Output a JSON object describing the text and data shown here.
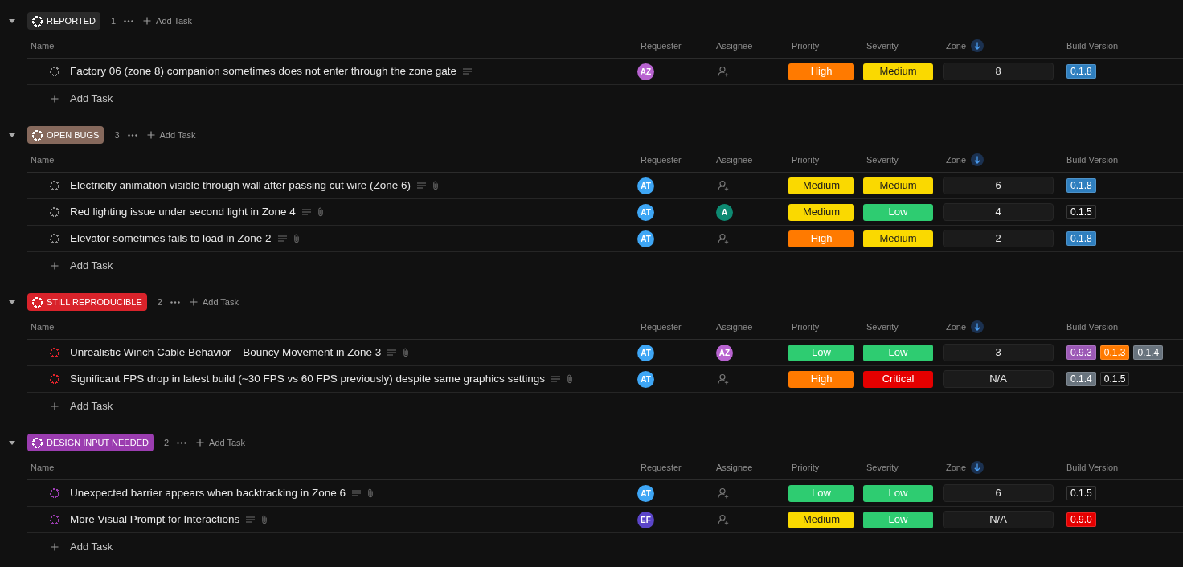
{
  "groups": [
    {
      "name": "REPORTED",
      "color": "#2a2a2a",
      "expanded": true,
      "count": "1",
      "add_task": "Add Task",
      "columns": [
        {
          "label": "Name",
          "sorted": false
        },
        {
          "label": "Requester",
          "sorted": false
        },
        {
          "label": "Assignee",
          "sorted": false
        },
        {
          "label": "Priority",
          "sorted": false
        },
        {
          "label": "Severity",
          "sorted": false
        },
        {
          "label": "Zone",
          "sorted": true
        },
        {
          "label": "Build Version",
          "sorted": false
        }
      ],
      "tasks": [
        {
          "name": "Factory 06 (zone 8) companion sometimes does not enter through the zone gate",
          "color": "#8f8f8f",
          "has_description": true,
          "has_attachment": false,
          "requester": {
            "initials": "AZ",
            "color": "#b863d0"
          },
          "priority": {
            "label": "High",
            "color": "#ff7a00"
          },
          "severity": {
            "label": "Medium",
            "color": "#fad900"
          },
          "zone": "8",
          "build_versions": [
            {
              "label": "0.1.8",
              "color": "#2f7fbf"
            }
          ]
        }
      ],
      "add_task_row": "Add Task"
    },
    {
      "name": "OPEN BUGS",
      "color": "#86695c",
      "expanded": true,
      "count": "3",
      "add_task": "Add Task",
      "columns": [
        {
          "label": "Name",
          "sorted": false
        },
        {
          "label": "Requester",
          "sorted": false
        },
        {
          "label": "Assignee",
          "sorted": false
        },
        {
          "label": "Priority",
          "sorted": false
        },
        {
          "label": "Severity",
          "sorted": false
        },
        {
          "label": "Zone",
          "sorted": true
        },
        {
          "label": "Build Version",
          "sorted": false
        }
      ],
      "tasks": [
        {
          "name": "Electricity animation visible through wall after passing cut wire (Zone 6)",
          "color": "#8f8f8f",
          "has_description": true,
          "has_attachment": true,
          "requester": {
            "initials": "AT",
            "color": "#3ea6f5"
          },
          "priority": {
            "label": "Medium",
            "color": "#fad900"
          },
          "severity": {
            "label": "Medium",
            "color": "#fad900"
          },
          "zone": "6",
          "build_versions": [
            {
              "label": "0.1.8",
              "color": "#2f7fbf"
            }
          ]
        },
        {
          "name": "Red lighting issue under second light in Zone 4",
          "color": "#8f8f8f",
          "has_description": true,
          "has_attachment": true,
          "requester": {
            "initials": "AT",
            "color": "#3ea6f5"
          },
          "assignee": {
            "initials": "A",
            "color": "#0e8a72"
          },
          "priority": {
            "label": "Medium",
            "color": "#fad900"
          },
          "severity": {
            "label": "Low",
            "color": "#2ecc71"
          },
          "zone": "4",
          "build_versions": [
            {
              "label": "0.1.5",
              "color": "#141414"
            }
          ]
        },
        {
          "name": "Elevator sometimes fails to load in Zone 2",
          "color": "#8f8f8f",
          "has_description": true,
          "has_attachment": true,
          "requester": {
            "initials": "AT",
            "color": "#3ea6f5"
          },
          "priority": {
            "label": "High",
            "color": "#ff7a00"
          },
          "severity": {
            "label": "Medium",
            "color": "#fad900"
          },
          "zone": "2",
          "build_versions": [
            {
              "label": "0.1.8",
              "color": "#2f7fbf"
            }
          ]
        }
      ],
      "add_task_row": "Add Task"
    },
    {
      "name": "STILL REPRODUCIBLE",
      "color": "#d9232b",
      "expanded": true,
      "count": "2",
      "add_task": "Add Task",
      "columns": [
        {
          "label": "Name",
          "sorted": false
        },
        {
          "label": "Requester",
          "sorted": false
        },
        {
          "label": "Assignee",
          "sorted": false
        },
        {
          "label": "Priority",
          "sorted": false
        },
        {
          "label": "Severity",
          "sorted": false
        },
        {
          "label": "Zone",
          "sorted": true
        },
        {
          "label": "Build Version",
          "sorted": false
        }
      ],
      "tasks": [
        {
          "name": "Unrealistic Winch Cable Behavior – Bouncy Movement in Zone 3",
          "color": "#e0242c",
          "has_description": true,
          "has_attachment": true,
          "requester": {
            "initials": "AT",
            "color": "#3ea6f5"
          },
          "assignee": {
            "initials": "AZ",
            "color": "#b863d0"
          },
          "priority": {
            "label": "Low",
            "color": "#2ecc71"
          },
          "severity": {
            "label": "Low",
            "color": "#2ecc71"
          },
          "zone": "3",
          "build_versions": [
            {
              "label": "0.9.3",
              "color": "#9c59b6"
            },
            {
              "label": "0.1.3",
              "color": "#ff7a00"
            },
            {
              "label": "0.1.4",
              "color": "#68737d"
            }
          ]
        },
        {
          "name": "Significant FPS drop in latest build (~30 FPS vs 60 FPS previously) despite same graphics settings",
          "color": "#e0242c",
          "has_description": true,
          "has_attachment": true,
          "requester": {
            "initials": "AT",
            "color": "#3ea6f5"
          },
          "priority": {
            "label": "High",
            "color": "#ff7a00"
          },
          "severity": {
            "label": "Critical",
            "color": "#e50000"
          },
          "zone": "N/A",
          "build_versions": [
            {
              "label": "0.1.4",
              "color": "#68737d"
            },
            {
              "label": "0.1.5",
              "color": "#141414"
            }
          ]
        }
      ],
      "add_task_row": "Add Task"
    },
    {
      "name": "DESIGN INPUT NEEDED",
      "color": "#9b3db0",
      "expanded": true,
      "count": "2",
      "add_task": "Add Task",
      "columns": [
        {
          "label": "Name",
          "sorted": false
        },
        {
          "label": "Requester",
          "sorted": false
        },
        {
          "label": "Assignee",
          "sorted": false
        },
        {
          "label": "Priority",
          "sorted": false
        },
        {
          "label": "Severity",
          "sorted": false
        },
        {
          "label": "Zone",
          "sorted": true
        },
        {
          "label": "Build Version",
          "sorted": false
        }
      ],
      "tasks": [
        {
          "name": "Unexpected barrier appears when backtracking in Zone 6",
          "color": "#9b3db0",
          "has_description": true,
          "has_attachment": true,
          "requester": {
            "initials": "AT",
            "color": "#3ea6f5"
          },
          "priority": {
            "label": "Low",
            "color": "#2ecc71"
          },
          "severity": {
            "label": "Low",
            "color": "#2ecc71"
          },
          "zone": "6",
          "build_versions": [
            {
              "label": "0.1.5",
              "color": "#141414"
            }
          ]
        },
        {
          "name": "More Visual Prompt for Interactions",
          "color": "#9b3db0",
          "has_description": true,
          "has_attachment": true,
          "requester": {
            "initials": "EF",
            "color": "#5b45c9"
          },
          "priority": {
            "label": "Medium",
            "color": "#fad900"
          },
          "severity": {
            "label": "Low",
            "color": "#2ecc71"
          },
          "zone": "N/A",
          "build_versions": [
            {
              "label": "0.9.0",
              "color": "#e50000"
            }
          ]
        }
      ],
      "add_task_row": "Add Task"
    }
  ]
}
